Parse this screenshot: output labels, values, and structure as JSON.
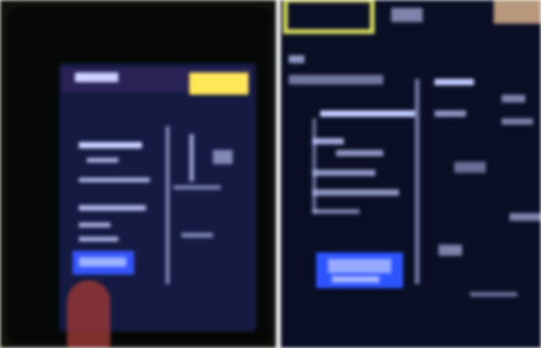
{
  "images": [
    {
      "kind": "photo",
      "scene": "dark-electronic-display",
      "colors": {
        "bezel": "#0e130c",
        "screen": "#151a3c",
        "highlight": "#ffe76a",
        "text": "#cfd4ff",
        "selection": "#3a56e8",
        "finger": "#8a3a38"
      }
    },
    {
      "kind": "photo",
      "scene": "dark-electronic-display-closeup",
      "colors": {
        "screen": "#0c1030",
        "frame": "#d8dc6c",
        "text": "#c9d0ff",
        "selection": "#3356f0",
        "accent": "#eec8a0"
      }
    }
  ]
}
